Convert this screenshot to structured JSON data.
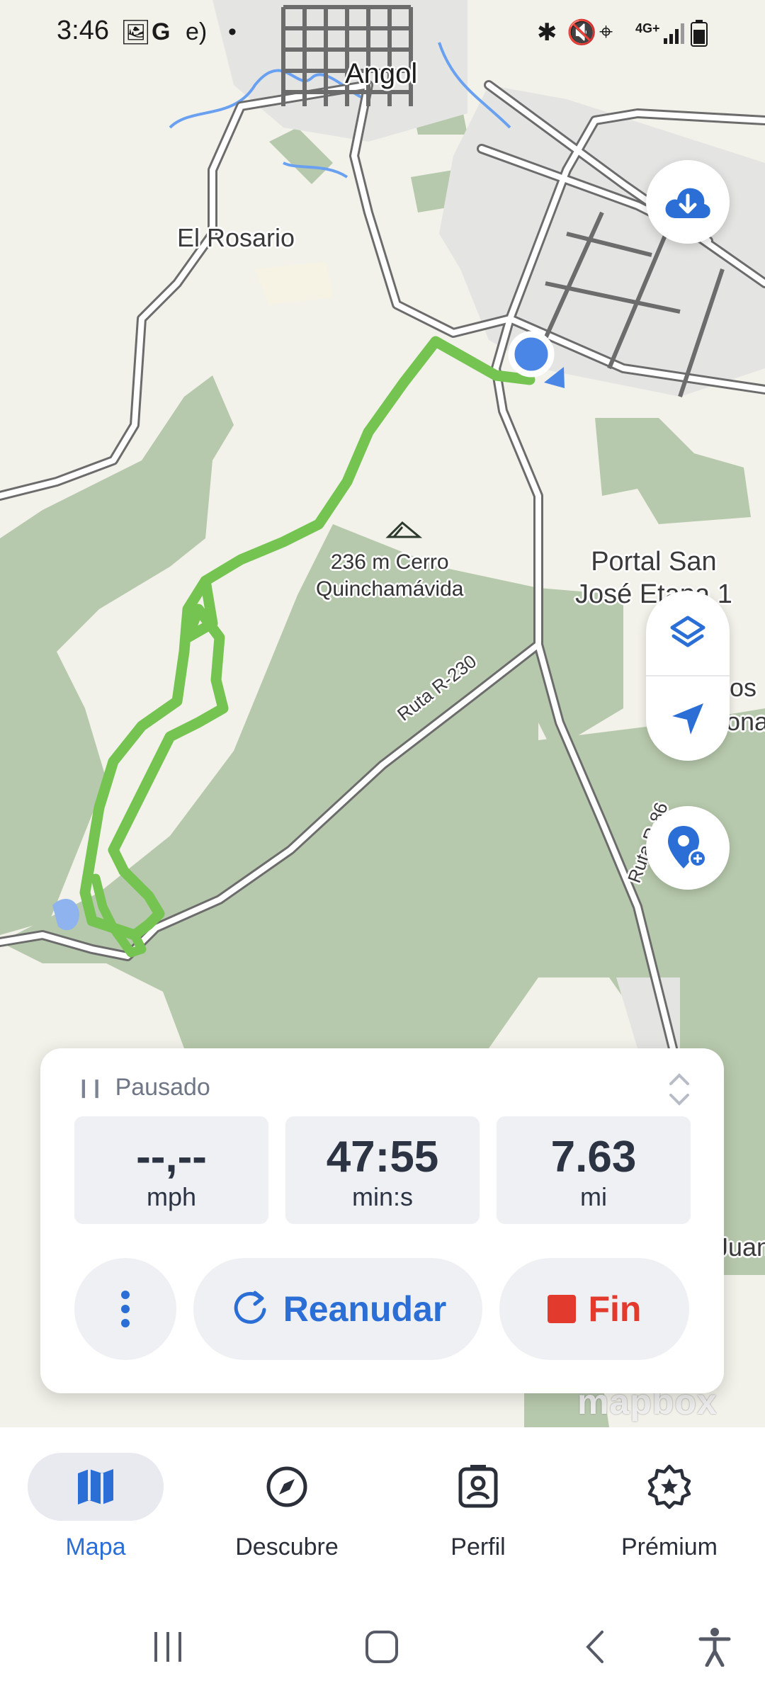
{
  "status_bar": {
    "time": "3:46",
    "left_icons": [
      "gallery-icon",
      "google-icon",
      "app-icon",
      "dot-icon"
    ],
    "right_icons": [
      "bluetooth-icon",
      "mute-icon",
      "location-icon",
      "signal-icon",
      "battery-icon"
    ],
    "network": "4G+"
  },
  "map": {
    "labels": {
      "city": "Angol",
      "town": "El Rosario",
      "peak_elevation": "236 m Cerro",
      "peak_name": "Quinchamávida",
      "portal_line1": "Portal San",
      "portal_line2": "José Etapa 1",
      "edge_label1": "os",
      "edge_label2": "ona",
      "edge_label3": "Juan",
      "road1": "Ruta R-230",
      "road2": "Ruta R-86"
    },
    "attribution": "mapbox",
    "colors": {
      "background": "#f3f2ea",
      "forest": "#b7c9ac",
      "urban": "#e4e5e3",
      "water": "#6aa0f0",
      "track": "#75c452",
      "road_outline": "#6c6c6c",
      "location_dot": "#4a86e6"
    }
  },
  "fabs": {
    "download": "cloud-download-icon",
    "layers": "layers-icon",
    "locate": "navigation-arrow-icon",
    "add_pin": "add-pin-icon"
  },
  "recording": {
    "status": "Pausado",
    "stats": [
      {
        "value": "--,--",
        "unit": "mph"
      },
      {
        "value": "47:55",
        "unit": "min:s"
      },
      {
        "value": "7.63",
        "unit": "mi"
      }
    ],
    "resume_label": "Reanudar",
    "end_label": "Fin",
    "accent": "#2b6fd6",
    "danger": "#e23b2e"
  },
  "bottom_nav": {
    "items": [
      {
        "label": "Mapa",
        "icon": "map-icon",
        "active": true
      },
      {
        "label": "Descubre",
        "icon": "compass-icon",
        "active": false
      },
      {
        "label": "Perfil",
        "icon": "profile-icon",
        "active": false
      },
      {
        "label": "Prémium",
        "icon": "premium-badge-icon",
        "active": false
      }
    ]
  },
  "system_nav": [
    "recents-icon",
    "home-icon",
    "back-icon",
    "accessibility-icon"
  ]
}
